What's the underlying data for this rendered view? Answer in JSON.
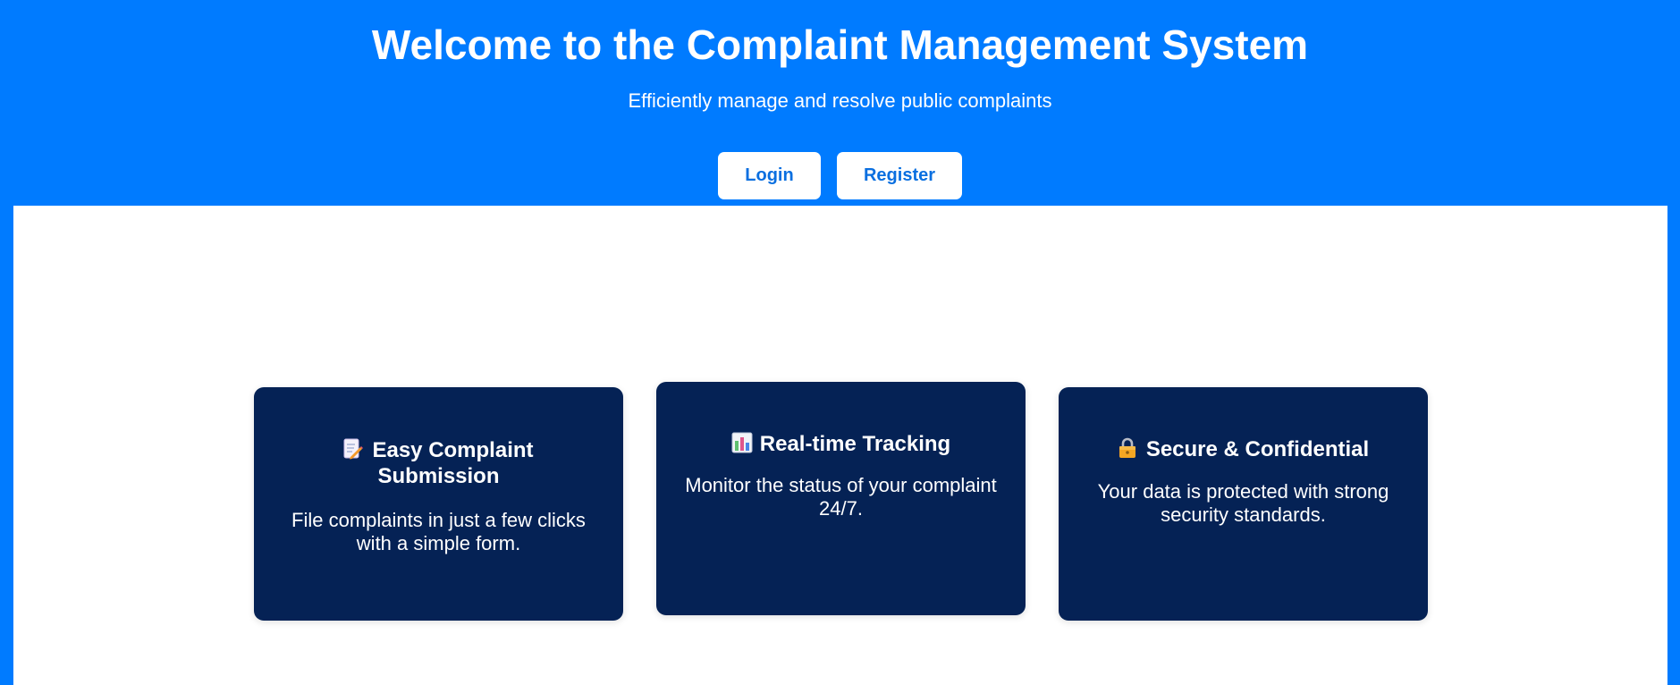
{
  "header": {
    "title": "Welcome to the Complaint Management System",
    "subtitle": "Efficiently manage and resolve public complaints",
    "login_label": "Login",
    "register_label": "Register"
  },
  "features": [
    {
      "icon": "memo-icon",
      "title": "Easy Complaint Submission",
      "text": "File complaints in just a few clicks with a simple form."
    },
    {
      "icon": "bar-chart-icon",
      "title": "Real-time Tracking",
      "text": "Monitor the status of your complaint 24/7."
    },
    {
      "icon": "lock-icon",
      "title": "Secure & Confidential",
      "text": "Your data is protected with strong security standards."
    }
  ],
  "colors": {
    "header_bg": "#007bff",
    "card_bg": "#052255",
    "button_text": "#0a6fe0"
  }
}
